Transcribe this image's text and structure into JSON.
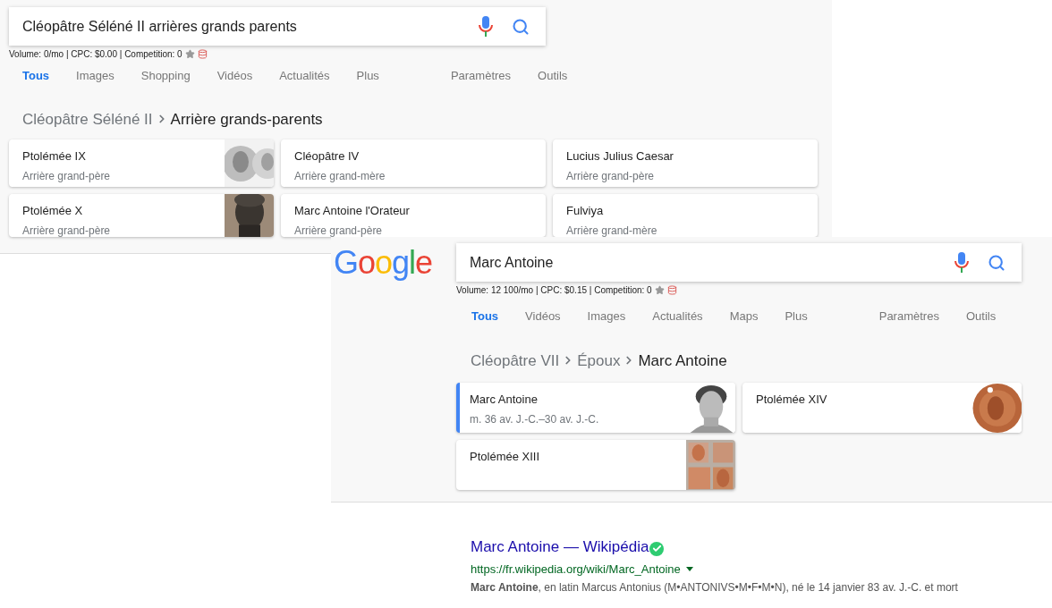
{
  "panels": [
    {
      "query": "Cléopâtre Séléné II arrières grands parents",
      "seo": "Volume: 0/mo | CPC: $0.00 | Competition: 0",
      "tabs": [
        {
          "label": "Tous",
          "selected": true
        },
        {
          "label": "Images",
          "selected": false
        },
        {
          "label": "Shopping",
          "selected": false
        },
        {
          "label": "Vidéos",
          "selected": false
        },
        {
          "label": "Actualités",
          "selected": false
        },
        {
          "label": "Plus",
          "selected": false
        }
      ],
      "tools": [
        "Paramètres",
        "Outils"
      ],
      "breadcrumb": [
        "Cléopâtre Séléné II",
        "Arrière grands-parents"
      ],
      "cards": [
        {
          "title": "Ptolémée IX",
          "subtitle": "Arrière grand-père",
          "kind": "picture",
          "selected": false
        },
        {
          "title": "Cléopâtre IV",
          "subtitle": "Arrière grand-mère",
          "kind": "plain",
          "selected": false
        },
        {
          "title": "Lucius Julius Caesar",
          "subtitle": "Arrière grand-père",
          "kind": "plain",
          "selected": false
        },
        {
          "title": "Ptolémée X",
          "subtitle": "Arrière grand-père",
          "kind": "picture",
          "selected": false
        },
        {
          "title": "Marc Antoine l'Orateur",
          "subtitle": "Arrière grand-père",
          "kind": "plain",
          "selected": false
        },
        {
          "title": "Fulviya",
          "subtitle": "Arrière grand-mère",
          "kind": "plain",
          "selected": false
        }
      ]
    },
    {
      "logo": "Google",
      "query": "Marc Antoine",
      "seo": "Volume: 12 100/mo | CPC: $0.15 | Competition: 0",
      "tabs": [
        {
          "label": "Tous",
          "selected": true
        },
        {
          "label": "Vidéos",
          "selected": false
        },
        {
          "label": "Images",
          "selected": false
        },
        {
          "label": "Actualités",
          "selected": false
        },
        {
          "label": "Maps",
          "selected": false
        },
        {
          "label": "Plus",
          "selected": false
        }
      ],
      "tools": [
        "Paramètres",
        "Outils"
      ],
      "breadcrumb": [
        "Cléopâtre VII",
        "Époux",
        "Marc Antoine"
      ],
      "cards": [
        {
          "title": "Marc Antoine",
          "subtitle": "m. 36 av. J.-C.–30 av. J.-C.",
          "kind": "picture",
          "selected": true
        },
        {
          "title": "Ptolémée XIV",
          "kind": "picture",
          "selected": false
        },
        {
          "title": "Ptolémée XIII",
          "kind": "picture",
          "selected": false
        }
      ],
      "result": {
        "title": "Marc Antoine — Wikipédia",
        "url": "https://fr.wikipedia.org/wiki/Marc_Antoine",
        "snippet": "**Marc Antoine**, en latin Marcus Antonius (M•ANTONIVS•M•F•M•N), né le 14 janvier 83 av. J.-C. et mort"
      }
    }
  ]
}
